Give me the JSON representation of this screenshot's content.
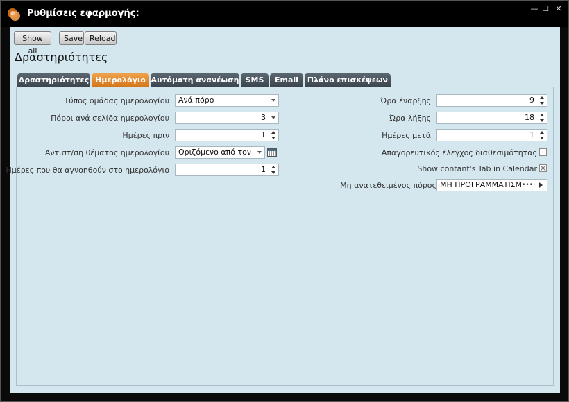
{
  "window": {
    "title": "Ρυθμίσεις εφαρμογής:",
    "controls": {
      "minimize": "—",
      "maximize": "☐",
      "close": "✕"
    }
  },
  "toolbar": {
    "show_all": "Show all",
    "save": "Save",
    "reload": "Reload"
  },
  "section_title": "Δραστηριότητες",
  "tabs": [
    {
      "label": "Δραστηριότητες",
      "active": false
    },
    {
      "label": "Ημερολόγιο",
      "active": true
    },
    {
      "label": "Αυτόματη ανανέωση",
      "active": false
    },
    {
      "label": "SMS",
      "active": false
    },
    {
      "label": "Email",
      "active": false
    },
    {
      "label": "Πλάνο επισκέψεων",
      "active": false
    }
  ],
  "left_fields": {
    "group_type": {
      "label": "Τύπος ομάδας ημερολογίου",
      "value": "Ανά πόρο"
    },
    "resources_per_page": {
      "label": "Πόροι ανά σελίδα ημερολογίου",
      "value": "3"
    },
    "days_before": {
      "label": "Ημέρες πριν",
      "value": "1"
    },
    "subject_mapping": {
      "label": "Αντιστ/ση θέματος ημερολογίου",
      "value": "Οριζόμενο από τον ..."
    },
    "days_ignored": {
      "label": "Ημέρες που θα αγνοηθούν στο ημερολόγιο",
      "value": "1"
    }
  },
  "right_fields": {
    "start_hour": {
      "label": "Ώρα έναρξης",
      "value": "9"
    },
    "end_hour": {
      "label": "Ώρα λήξης",
      "value": "18"
    },
    "days_after": {
      "label": "Ημέρες μετά",
      "value": "1"
    },
    "availability_check": {
      "label": "Απαγορευτικός έλεγχος διαθεσιμότητας",
      "checked": false
    },
    "show_contact_tab": {
      "label": "Show contant's Tab in Calendar",
      "checked": true
    },
    "unassigned_resource": {
      "label": "Μη ανατεθειμένος πόρος",
      "value": "ΜΗ ΠΡΟΓΡΑΜΜΑΤΙΣΜΕΝ",
      "ellipsis": "•••"
    }
  },
  "colors": {
    "active_tab": "#e08a2a",
    "tab": "#4a5660",
    "panel_bg": "#d4e6ee"
  }
}
